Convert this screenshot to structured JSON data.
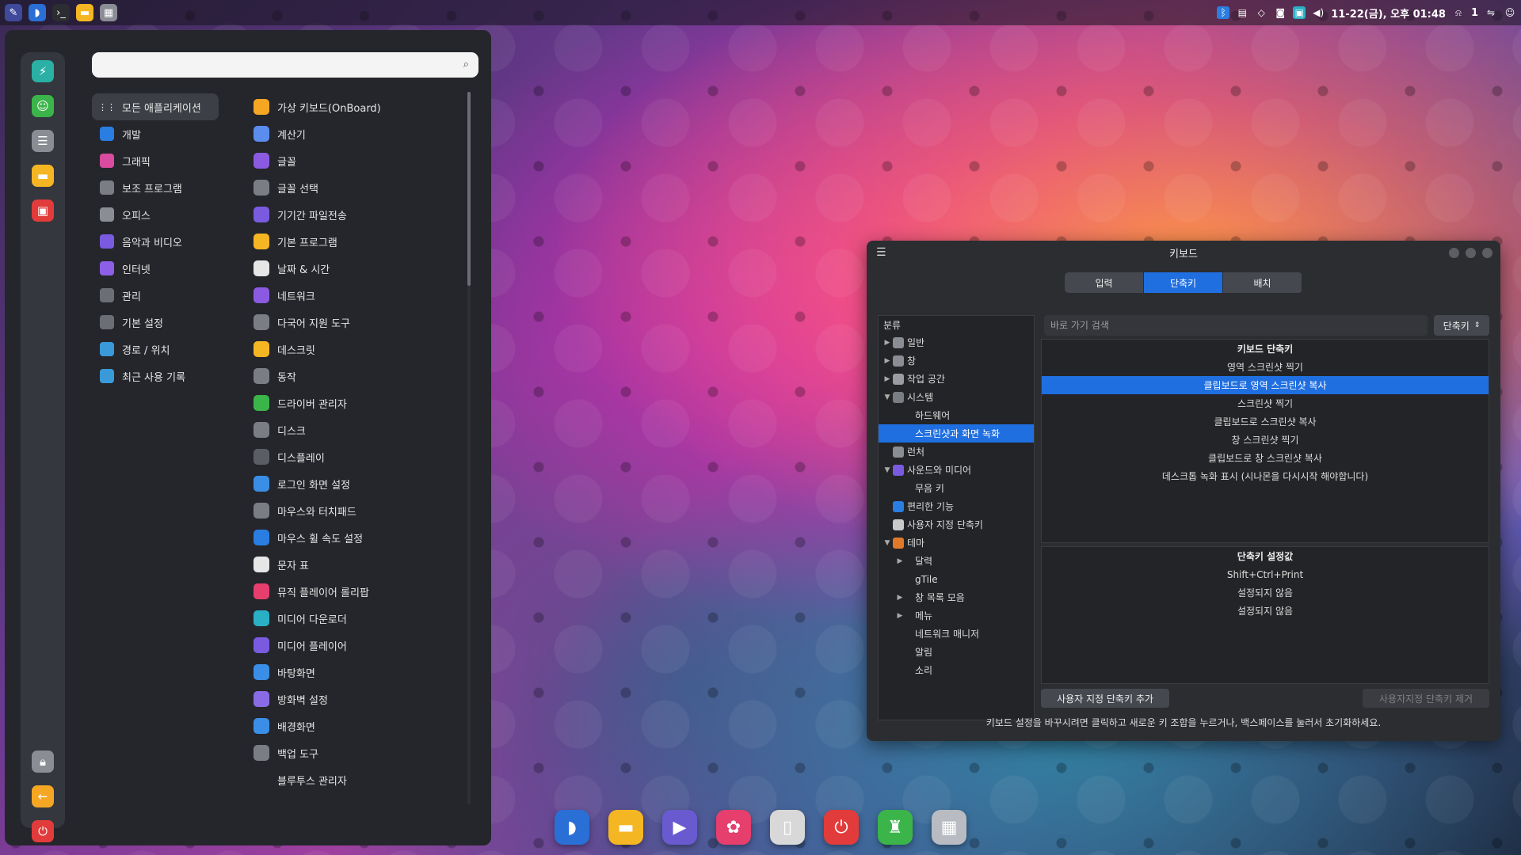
{
  "colors": {
    "accent": "#1f6fe0",
    "menu_bg": "#24262b",
    "window_bg": "#2b2d31"
  },
  "top_panel": {
    "left_icons": [
      "pen-icon",
      "browser-icon",
      "terminal-icon",
      "files-icon",
      "app-grid-icon"
    ],
    "clock": "11-22(금), 오후 01:48",
    "notif_count": "1",
    "tray_icons": [
      "bluetooth-icon",
      "clipboard-icon",
      "shield-icon",
      "camera-icon",
      "monitor-icon",
      "volume-icon",
      "notification-icon",
      "network-icon",
      "user-icon"
    ]
  },
  "menu": {
    "search": {
      "placeholder": "",
      "value": ""
    },
    "rail": [
      "app-1-icon",
      "user-admin-icon",
      "settings-icon",
      "files-icon",
      "store-icon",
      "lock-icon",
      "logout-icon",
      "power-icon"
    ],
    "categories": [
      {
        "label": "모든 애플리케이션",
        "icon": "grid-icon",
        "color": "#3c3f46"
      },
      {
        "label": "개발",
        "icon": "hammer-icon",
        "color": "#2a7de1"
      },
      {
        "label": "그래픽",
        "icon": "brush-icon",
        "color": "#d84b9e"
      },
      {
        "label": "보조 프로그램",
        "icon": "accessory-icon",
        "color": "#7a7d84"
      },
      {
        "label": "오피스",
        "icon": "office-icon",
        "color": "#8a8d94"
      },
      {
        "label": "음악과 비디오",
        "icon": "play-icon",
        "color": "#7a5be0"
      },
      {
        "label": "인터넷",
        "icon": "internet-icon",
        "color": "#8d5fe6"
      },
      {
        "label": "관리",
        "icon": "gear-icon",
        "color": "#6b6e75"
      },
      {
        "label": "기본 설정",
        "icon": "preferences-icon",
        "color": "#6b6e75"
      },
      {
        "label": "경로 / 위치",
        "icon": "folder-icon",
        "color": "#3a9ad9"
      },
      {
        "label": "최근 사용 기록",
        "icon": "history-folder-icon",
        "color": "#3a9ad9"
      }
    ],
    "apps": [
      {
        "label": "가상 키보드(OnBoard)",
        "color": "#f5a623"
      },
      {
        "label": "계산기",
        "color": "#5b8def"
      },
      {
        "label": "글꼴",
        "color": "#8a5be0"
      },
      {
        "label": "글꼴 선택",
        "color": "#7a7d84"
      },
      {
        "label": "기기간 파일전송",
        "color": "#7a5be0"
      },
      {
        "label": "기본 프로그램",
        "color": "#f5b623"
      },
      {
        "label": "날짜 & 시간",
        "color": "#e6e6e6"
      },
      {
        "label": "네트워크",
        "color": "#8a5be0"
      },
      {
        "label": "다국어 지원 도구",
        "color": "#7a7d84"
      },
      {
        "label": "데스크릿",
        "color": "#f5b623"
      },
      {
        "label": "동작",
        "color": "#7a7d84"
      },
      {
        "label": "드라이버 관리자",
        "color": "#3bb54a"
      },
      {
        "label": "디스크",
        "color": "#7a7d84"
      },
      {
        "label": "디스플레이",
        "color": "#5a5d64"
      },
      {
        "label": "로그인 화면 설정",
        "color": "#3a8ee6"
      },
      {
        "label": "마우스와 터치패드",
        "color": "#7a7d84"
      },
      {
        "label": "마우스 휠 속도 설정",
        "color": "#2a7de1"
      },
      {
        "label": "문자 표",
        "color": "#e6e6e6"
      },
      {
        "label": "뮤직 플레이어 롤리팝",
        "color": "#e63e6d"
      },
      {
        "label": "미디어 다운로더",
        "color": "#2ab0c5"
      },
      {
        "label": "미디어 플레이어",
        "color": "#7a5be0"
      },
      {
        "label": "바탕화면",
        "color": "#3a8ee6"
      },
      {
        "label": "방화벽 설정",
        "color": "#8a6be6"
      },
      {
        "label": "배경화면",
        "color": "#3a8ee6"
      },
      {
        "label": "백업 도구",
        "color": "#7a7d84"
      },
      {
        "label": "블루투스 관리자",
        "color": "#24262b"
      }
    ]
  },
  "keyboard_window": {
    "title": "키보드",
    "tabs": [
      {
        "label": "입력",
        "active": false
      },
      {
        "label": "단축키",
        "active": true
      },
      {
        "label": "배치",
        "active": false
      }
    ],
    "tree_header": "분류",
    "tree": [
      {
        "label": "일반",
        "level": 0,
        "arrow": "▶",
        "icon_color": "#8a8d94",
        "selected": false
      },
      {
        "label": "창",
        "level": 0,
        "arrow": "▶",
        "icon_color": "#8a8d94",
        "selected": false
      },
      {
        "label": "작업 공간",
        "level": 0,
        "arrow": "▶",
        "icon_color": "#9a9ca1",
        "selected": false
      },
      {
        "label": "시스템",
        "level": 0,
        "arrow": "▼",
        "icon_color": "#7a7d84",
        "selected": false
      },
      {
        "label": "하드웨어",
        "level": 1,
        "arrow": "",
        "icon_color": "",
        "selected": false
      },
      {
        "label": "스크린샷과 화면 녹화",
        "level": 1,
        "arrow": "",
        "icon_color": "",
        "selected": true
      },
      {
        "label": "런처",
        "level": 0,
        "arrow": "",
        "icon_color": "#8a8d94",
        "selected": false
      },
      {
        "label": "사운드와 미디어",
        "level": 0,
        "arrow": "▼",
        "icon_color": "#7a5be0",
        "selected": false
      },
      {
        "label": "무음 키",
        "level": 1,
        "arrow": "",
        "icon_color": "",
        "selected": false
      },
      {
        "label": "편리한 기능",
        "level": 0,
        "arrow": "",
        "icon_color": "#2a7de1",
        "selected": false
      },
      {
        "label": "사용자 지정 단축키",
        "level": 0,
        "arrow": "",
        "icon_color": "#c9c9c9",
        "selected": false
      },
      {
        "label": "테마",
        "level": 0,
        "arrow": "▼",
        "icon_color": "#e07a2a",
        "selected": false
      },
      {
        "label": "달력",
        "level": 1,
        "arrow": "▶",
        "icon_color": "",
        "selected": false
      },
      {
        "label": "gTile",
        "level": 1,
        "arrow": "",
        "icon_color": "",
        "selected": false
      },
      {
        "label": "창 목록 모음",
        "level": 1,
        "arrow": "▶",
        "icon_color": "",
        "selected": false
      },
      {
        "label": "메뉴",
        "level": 1,
        "arrow": "▶",
        "icon_color": "",
        "selected": false
      },
      {
        "label": "네트워크 매니저",
        "level": 1,
        "arrow": "",
        "icon_color": "",
        "selected": false
      },
      {
        "label": "알림",
        "level": 1,
        "arrow": "",
        "icon_color": "",
        "selected": false
      },
      {
        "label": "소리",
        "level": 1,
        "arrow": "",
        "icon_color": "",
        "selected": false
      }
    ],
    "search_placeholder": "바로 가기 검색",
    "filter_label": "단축키",
    "shortcuts_header": "키보드 단축키",
    "shortcuts": [
      {
        "label": "영역 스크린샷 찍기",
        "selected": false
      },
      {
        "label": "클립보드로 영역 스크린샷 복사",
        "selected": true
      },
      {
        "label": "스크린샷 찍기",
        "selected": false
      },
      {
        "label": "클립보드로 스크린샷 복사",
        "selected": false
      },
      {
        "label": "창 스크린샷 찍기",
        "selected": false
      },
      {
        "label": "클립보드로 창 스크린샷 복사",
        "selected": false
      },
      {
        "label": "데스크톱 녹화 표시 (시나몬을 다시시작 해야합니다)",
        "selected": false
      }
    ],
    "bindings_header": "단축키 설정값",
    "bindings": [
      "Shift+Ctrl+Print",
      "설정되지 않음",
      "설정되지 않음"
    ],
    "add_button": "사용자 지정 단축키 추가",
    "remove_button": "사용자지정 단축키 제거",
    "hint": "키보드 설정을 바꾸시려면 클릭하고 새로운 키 조합을 누르거나, 백스페이스를 눌러서 초기화하세요."
  },
  "dock": [
    {
      "name": "browser-icon",
      "color": "#2a6fd6",
      "glyph": "◗"
    },
    {
      "name": "files-icon",
      "color": "#f5b623",
      "glyph": "▬"
    },
    {
      "name": "media-player-icon",
      "color": "#6a5ad0",
      "glyph": "▶"
    },
    {
      "name": "music-player-icon",
      "color": "#e63e6d",
      "glyph": "✿"
    },
    {
      "name": "trash-icon",
      "color": "#d8d8d8",
      "glyph": "▯"
    },
    {
      "name": "power-icon",
      "color": "#e23b3b",
      "glyph": "⏻"
    },
    {
      "name": "store-icon",
      "color": "#3bb54a",
      "glyph": "♜"
    },
    {
      "name": "app-grid-icon",
      "color": "#b8bcc2",
      "glyph": "▦"
    }
  ]
}
